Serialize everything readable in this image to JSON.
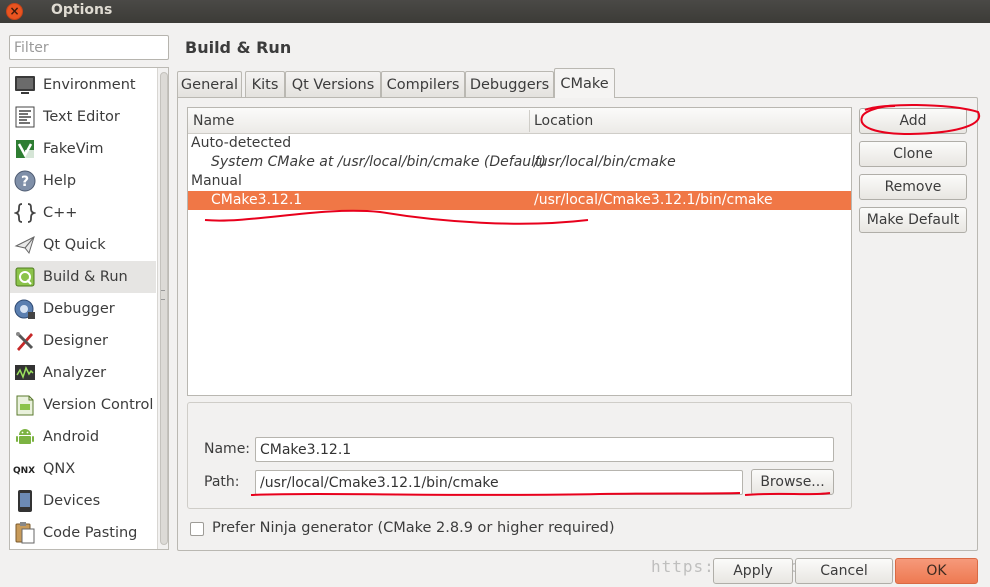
{
  "window": {
    "title": "Options",
    "close_glyph": "×"
  },
  "filter": {
    "placeholder": "Filter",
    "value": ""
  },
  "sidebar": {
    "selected": "Build & Run",
    "items": [
      {
        "label": "Environment",
        "icon": "monitor-icon"
      },
      {
        "label": "Text Editor",
        "icon": "text-editor-icon"
      },
      {
        "label": "FakeVim",
        "icon": "fakevim-icon"
      },
      {
        "label": "Help",
        "icon": "help-icon"
      },
      {
        "label": "C++",
        "icon": "braces-icon"
      },
      {
        "label": "Qt Quick",
        "icon": "paper-plane-icon"
      },
      {
        "label": "Build & Run",
        "icon": "build-run-icon"
      },
      {
        "label": "Debugger",
        "icon": "debugger-icon"
      },
      {
        "label": "Designer",
        "icon": "designer-icon"
      },
      {
        "label": "Analyzer",
        "icon": "analyzer-icon"
      },
      {
        "label": "Version Control",
        "icon": "version-control-icon"
      },
      {
        "label": "Android",
        "icon": "android-icon"
      },
      {
        "label": "QNX",
        "icon": "qnx-icon"
      },
      {
        "label": "Devices",
        "icon": "devices-icon"
      },
      {
        "label": "Code Pasting",
        "icon": "clipboard-icon"
      }
    ]
  },
  "page": {
    "title": "Build & Run"
  },
  "tabs": {
    "active": "CMake",
    "items": [
      "General",
      "Kits",
      "Qt Versions",
      "Compilers",
      "Debuggers",
      "CMake"
    ]
  },
  "tree": {
    "headers": {
      "name": "Name",
      "location": "Location"
    },
    "groups": [
      {
        "label": "Auto-detected",
        "rows": [
          {
            "name": "System CMake at /usr/local/bin/cmake (Default)",
            "location": "/usr/local/bin/cmake"
          }
        ]
      },
      {
        "label": "Manual",
        "rows": [
          {
            "name": "CMake3.12.1",
            "location": "/usr/local/Cmake3.12.1/bin/cmake",
            "selected": true
          }
        ]
      }
    ]
  },
  "side_buttons": {
    "add": "Add",
    "clone": "Clone",
    "remove": "Remove",
    "make_default": "Make Default"
  },
  "details": {
    "name_label": "Name:",
    "name_value": "CMake3.12.1",
    "path_label": "Path:",
    "path_value": "/usr/local/Cmake3.12.1/bin/cmake",
    "browse": "Browse..."
  },
  "ninja": {
    "label": "Prefer Ninja generator (CMake 2.8.9 or higher required)",
    "checked": false
  },
  "dialog_buttons": {
    "apply": "Apply",
    "cancel": "Cancel",
    "ok": "OK"
  },
  "watermark": "https://blog.csdn.net/qq",
  "colors": {
    "accent": "#f07746",
    "annotation": "#e8001c",
    "titlebar": "#3c3b37"
  }
}
